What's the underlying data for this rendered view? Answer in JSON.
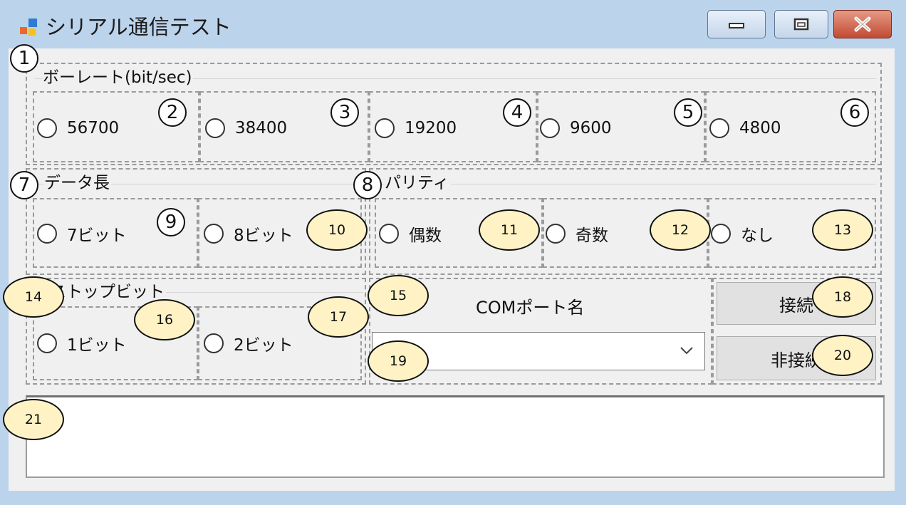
{
  "window": {
    "title": "シリアル通信テスト",
    "app_icon": "app-window-icon",
    "controls": [
      "minimize-icon",
      "maximize-icon",
      "close-icon"
    ]
  },
  "baud_group": {
    "label": "ボーレート(bit/sec)",
    "options": [
      "56700",
      "38400",
      "19200",
      "9600",
      "4800"
    ]
  },
  "data_length_group": {
    "label": "データ長",
    "options": [
      "7ビット",
      "8ビット"
    ]
  },
  "parity_group": {
    "label": "パリティ",
    "options": [
      "偶数",
      "奇数",
      "なし"
    ]
  },
  "stop_bit_group": {
    "label": "ストップビット",
    "options": [
      "1ビット",
      "2ビット"
    ]
  },
  "com_port": {
    "label": "COMポート名",
    "selected": "",
    "dropdown_icon": "chevron-down-icon"
  },
  "buttons": {
    "connect": "接続",
    "disconnect": "非接続"
  },
  "log": {
    "value": ""
  },
  "annotations": [
    "1",
    "2",
    "3",
    "4",
    "5",
    "6",
    "7",
    "8",
    "9",
    "10",
    "11",
    "12",
    "13",
    "14",
    "15",
    "16",
    "17",
    "18",
    "19",
    "20",
    "21"
  ],
  "colors": {
    "titlebar": "#bcd3ec",
    "client": "#f0f0f0",
    "close_button": "#c24a31",
    "annotation_fill": "#fff3c6"
  }
}
